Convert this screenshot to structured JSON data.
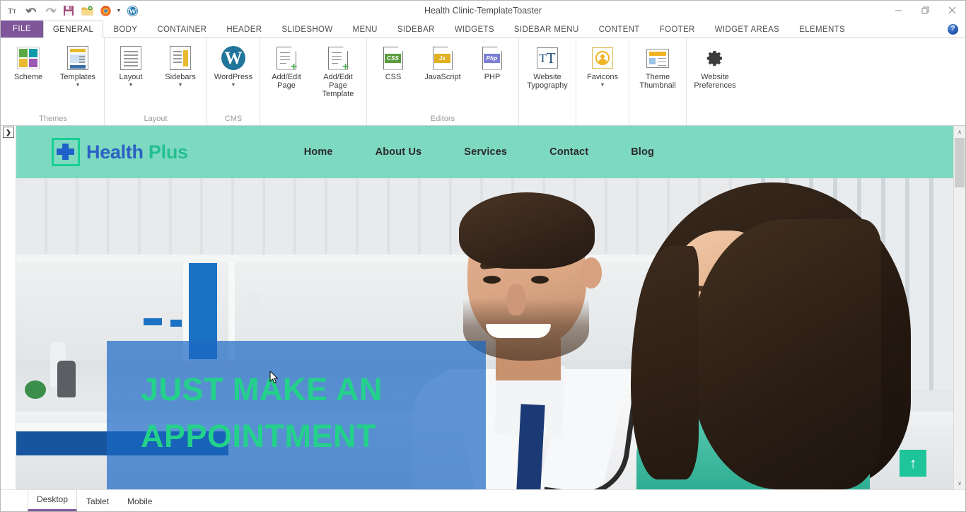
{
  "window": {
    "title": "Health Clinic-TemplateToaster",
    "controls": {
      "minimize": "—",
      "restore": "❐",
      "close": "✕"
    },
    "help_label": "?"
  },
  "quick_access": [
    {
      "name": "text-tool-icon",
      "glyph": "Tт"
    },
    {
      "name": "undo-icon",
      "glyph": "↶"
    },
    {
      "name": "redo-icon",
      "glyph": "↷"
    },
    {
      "name": "save-icon",
      "glyph": "💾"
    },
    {
      "name": "export-folder-icon",
      "glyph": "📂"
    },
    {
      "name": "preview-browser-icon",
      "glyph": "🦊"
    },
    {
      "name": "wordpress-icon",
      "glyph": "W"
    }
  ],
  "ribbon": {
    "file_tab": "FILE",
    "tabs": [
      {
        "label": "GENERAL",
        "active": true
      },
      {
        "label": "BODY",
        "active": false
      },
      {
        "label": "CONTAINER",
        "active": false
      },
      {
        "label": "HEADER",
        "active": false
      },
      {
        "label": "SLIDESHOW",
        "active": false
      },
      {
        "label": "MENU",
        "active": false
      },
      {
        "label": "SIDEBAR",
        "active": false
      },
      {
        "label": "WIDGETS",
        "active": false
      },
      {
        "label": "SIDEBAR MENU",
        "active": false
      },
      {
        "label": "CONTENT",
        "active": false
      },
      {
        "label": "FOOTER",
        "active": false
      },
      {
        "label": "WIDGET AREAS",
        "active": false
      },
      {
        "label": "ELEMENTS",
        "active": false
      }
    ],
    "groups": [
      {
        "label": "Themes",
        "items": [
          {
            "label": "Scheme",
            "icon": "scheme-icon",
            "dropdown": false
          },
          {
            "label": "Templates",
            "icon": "templates-icon",
            "dropdown": true
          }
        ]
      },
      {
        "label": "Layout",
        "items": [
          {
            "label": "Layout",
            "icon": "layout-icon",
            "dropdown": true
          },
          {
            "label": "Sidebars",
            "icon": "sidebars-icon",
            "dropdown": true
          }
        ]
      },
      {
        "label": "CMS",
        "items": [
          {
            "label": "WordPress",
            "icon": "wordpress-icon",
            "dropdown": true
          }
        ]
      },
      {
        "label": "",
        "items": [
          {
            "label": "Add/Edit Page",
            "icon": "add-edit-page-icon",
            "dropdown": false
          },
          {
            "label": "Add/Edit Page Template",
            "icon": "add-edit-page-template-icon",
            "dropdown": false
          }
        ]
      },
      {
        "label": "Editors",
        "items": [
          {
            "label": "CSS",
            "icon": "css-file-icon",
            "tag": "CSS",
            "tag_color": "#5b9c3e",
            "dropdown": false
          },
          {
            "label": "JavaScript",
            "icon": "js-file-icon",
            "tag": "Js",
            "tag_color": "#e0b021",
            "dropdown": false
          },
          {
            "label": "PHP",
            "icon": "php-file-icon",
            "tag": "Php",
            "tag_color": "#7b7fd4",
            "dropdown": false
          }
        ]
      },
      {
        "label": "",
        "items": [
          {
            "label": "Website Typography",
            "icon": "typography-icon",
            "dropdown": false
          }
        ]
      },
      {
        "label": "",
        "items": [
          {
            "label": "Favicons",
            "icon": "favicon-icon",
            "dropdown": true
          }
        ]
      },
      {
        "label": "",
        "items": [
          {
            "label": "Theme Thumbnail",
            "icon": "theme-thumbnail-icon",
            "dropdown": false
          }
        ]
      },
      {
        "label": "",
        "items": [
          {
            "label": "Website Preferences",
            "icon": "gear-icon",
            "dropdown": false
          }
        ]
      }
    ],
    "scheme_colors": [
      "#5aa845",
      "#0f9aa8",
      "#e8b931",
      "#9b59b6"
    ]
  },
  "canvas": {
    "expand_button": "❯",
    "vertical_scroll": {
      "up": "∧",
      "down": "∨"
    },
    "horizontal_scroll": {
      "left": "‹",
      "right": "›"
    }
  },
  "site": {
    "header_bg": "#7ed9c1",
    "logo": {
      "primary": "Health",
      "secondary": "Plus",
      "primary_color": "#2c5fc4",
      "secondary_color": "#23c08f"
    },
    "nav": [
      {
        "label": "Home"
      },
      {
        "label": "About Us"
      },
      {
        "label": "Services"
      },
      {
        "label": "Contact"
      },
      {
        "label": "Blog"
      }
    ],
    "hero": {
      "heading_line1": "JUST MAKE AN",
      "heading_line2": "APPOINTMENT",
      "heading_color": "#23d18b",
      "overlay_color": "rgba(27,104,196,0.70)",
      "to_top_glyph": "↑",
      "to_top_color": "#1ec49a"
    }
  },
  "device_tabs": [
    {
      "label": "Desktop",
      "active": true
    },
    {
      "label": "Tablet",
      "active": false
    },
    {
      "label": "Mobile",
      "active": false
    }
  ]
}
